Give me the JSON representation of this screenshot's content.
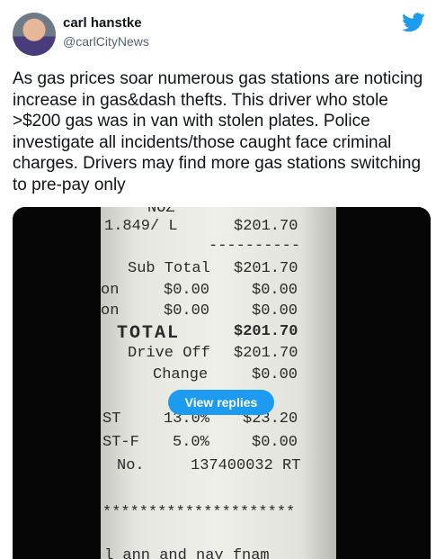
{
  "author": {
    "name": "carl hanstke",
    "handle": "@carlCityNews"
  },
  "icons": {
    "brand": "twitter-bird-icon",
    "brand_color": "#1d9bf0"
  },
  "tweet": {
    "text": "As gas prices soar numerous gas stations are noticing increase in gas&dash thefts. This driver who stole >$200 gas was in van with stolen plates. Police investigate all incidents/those caught face criminal charges. Drivers may find more gas stations switching to pre-pay only"
  },
  "media": {
    "view_replies_label": "View replies",
    "receipt": {
      "top_fragment": "NOZ",
      "price_line_left": "1.849/ L",
      "price_line_right": "$201.70",
      "dash_line": "----------",
      "subtotal_label": "Sub Total",
      "subtotal_value": "$201.70",
      "row1_left": "on",
      "row1_mid": "$0.00",
      "row1_right": "$0.00",
      "row2_left": "on",
      "row2_mid": "$0.00",
      "row2_right": "$0.00",
      "total_label": "TOTAL",
      "total_value": "$201.70",
      "driveoff_label": "Drive Off",
      "driveoff_value": "$201.70",
      "change_label": "Change",
      "change_value": "$0.00",
      "tax1_label": "ST",
      "tax1_rate": "13.0%",
      "tax1_value": "$23.20",
      "tax2_label": "ST-F",
      "tax2_rate": "5.0%",
      "tax2_value": "$0.00",
      "no_label": "No.",
      "no_value": "137400032 RT",
      "stars": "*********************",
      "bottom_fragment": "l ann and nay fnam"
    }
  }
}
